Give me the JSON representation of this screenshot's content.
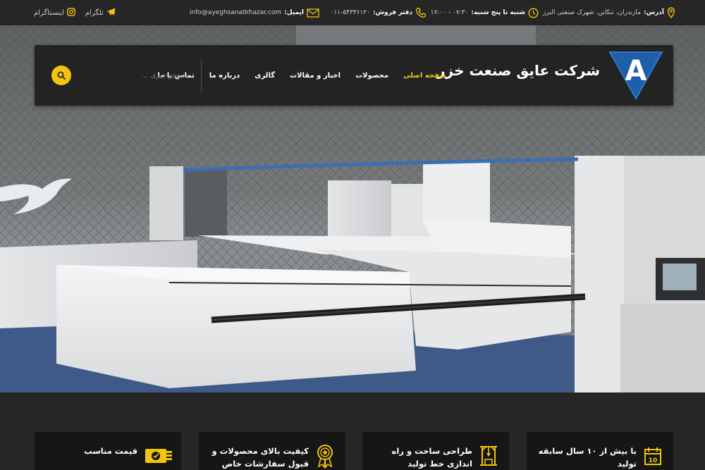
{
  "topbar": {
    "address_label": "آدرس:",
    "address_value": "مازندران، تنکابن، شهرک صنعتی البرز",
    "hours_label": "شنبه تا پنج شنبه:",
    "hours_value": "۰۷:۳۰ - ۱۷:۰۰",
    "sales_label": "دفتر فروش:",
    "sales_value": "۰۱۱-۵۴۳۳۶۱۲۰",
    "email_label": "ایمیل:",
    "email_value": "info@ayeghsanatkhazar.com",
    "telegram_label": "تلگرام",
    "instagram_label": "اینستاگرام"
  },
  "header": {
    "brand_name": "شرکت عایق صنعت خزر",
    "logo_letter": "A",
    "nav": [
      {
        "label": "صفحه اصلی",
        "active": true
      },
      {
        "label": "محصولات",
        "active": false
      },
      {
        "label": "اخبار و مقالات",
        "active": false
      },
      {
        "label": "گالری",
        "active": false
      },
      {
        "label": "درباره ما",
        "active": false
      },
      {
        "label": "تماس با ما",
        "active": false
      }
    ],
    "search_placeholder": "جستجو چیزی ..."
  },
  "features": [
    {
      "text": "با بیش از ۱۰ سال سابقه تولید",
      "icon": "calendar-icon"
    },
    {
      "text": "طراحی ساخت و راه اندازی خط تولید",
      "icon": "crane-icon"
    },
    {
      "text": "کیفیت بالای محصولات و قبول سفارشات خاص",
      "icon": "badge-icon"
    },
    {
      "text": "قیمت مناسب",
      "icon": "money-icon"
    }
  ],
  "colors": {
    "accent": "#f1c40f",
    "background": "#262626",
    "header_card": "#232323",
    "logo_blue": "#1d5fa8"
  }
}
